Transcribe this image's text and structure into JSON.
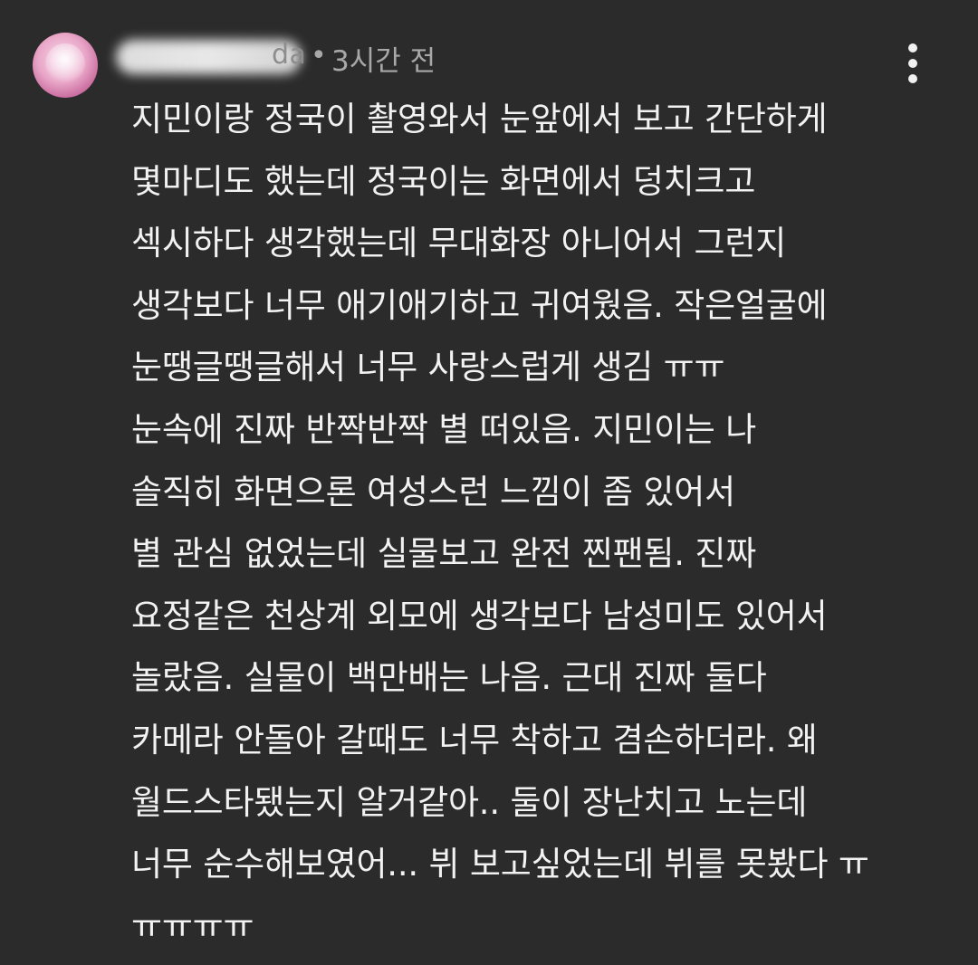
{
  "comment": {
    "author_suffix": "da",
    "separator": "•",
    "timestamp": "3시간 전",
    "lines": [
      "지민이랑 정국이 촬영와서 눈앞에서 보고 간단하게",
      "몇마디도 했는데 정국이는 화면에서 덩치크고",
      "섹시하다 생각했는데 무대화장 아니어서 그런지",
      "생각보다 너무 애기애기하고 귀여웠음. 작은얼굴에",
      "눈땡글땡글해서 너무 사랑스럽게 생김 ㅠㅠ",
      "눈속에 진짜 반짝반짝 별 떠있음. 지민이는 나",
      "솔직히 화면으론 여성스런 느낌이 좀 있어서",
      "별 관심 없었는데 실물보고 완전 찐팬됨. 진짜",
      "요정같은 천상계 외모에 생각보다 남성미도 있어서",
      "놀랐음. 실물이 백만배는 나음. 근대 진짜 둘다",
      "카메라 안돌아 갈때도 너무 착하고 겸손하더라. 왜",
      "월드스타됐는지 알거같아.. 둘이 장난치고 노는데",
      "너무 순수해보였어... 뷔 보고싶었는데 뷔를 못봤다 ㅠ",
      "ㅠㅠㅠㅠ"
    ]
  },
  "icons": {
    "more": "kebab-menu-icon",
    "avatar": "avatar"
  },
  "colors": {
    "background": "#2b2b2b",
    "text": "#f2f2f2",
    "meta": "#a8a8a8"
  }
}
